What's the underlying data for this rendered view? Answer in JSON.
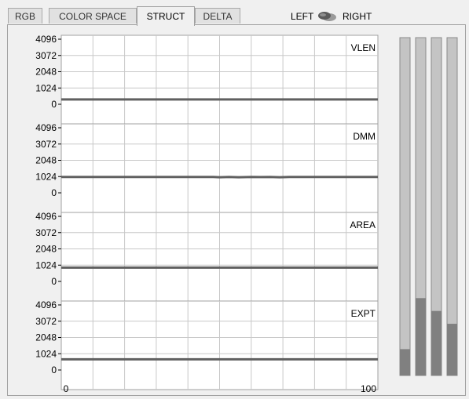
{
  "tabs": [
    {
      "label": "RGB",
      "active": false
    },
    {
      "label": "COLOR SPACE",
      "active": false
    },
    {
      "label": "STRUCT",
      "active": true
    },
    {
      "label": "DELTA",
      "active": false
    }
  ],
  "switch": {
    "left_label": "LEFT",
    "right_label": "RIGHT"
  },
  "charts": [
    {
      "name": "VLEN",
      "yticks": [
        "4096",
        "3072",
        "2048",
        "1024",
        "0"
      ],
      "series": [
        [
          0,
          300
        ],
        [
          100,
          300
        ]
      ]
    },
    {
      "name": "DMM",
      "yticks": [
        "4096",
        "3072",
        "2048",
        "1024",
        "0"
      ],
      "series": [
        [
          0,
          1000
        ],
        [
          48,
          1000
        ],
        [
          50,
          980
        ],
        [
          53,
          1000
        ],
        [
          56,
          980
        ],
        [
          60,
          1000
        ],
        [
          63,
          990
        ],
        [
          66,
          1000
        ],
        [
          69,
          980
        ],
        [
          72,
          1000
        ],
        [
          100,
          1000
        ]
      ]
    },
    {
      "name": "AREA",
      "yticks": [
        "4096",
        "3072",
        "2048",
        "1024",
        "0"
      ],
      "series": [
        [
          0,
          870
        ],
        [
          100,
          870
        ]
      ]
    },
    {
      "name": "EXPT",
      "yticks": [
        "4096",
        "3072",
        "2048",
        "1024",
        "0"
      ],
      "series": [
        [
          0,
          670
        ],
        [
          100,
          670
        ]
      ]
    }
  ],
  "x_axis": {
    "min": "0",
    "max": "100"
  },
  "bars": [
    0.078,
    0.229,
    0.191,
    0.153
  ],
  "colors": {
    "line": "#606060",
    "bar_fill": "#808080",
    "bar_track": "#c4c4c4",
    "grid": "#c8c8c8"
  }
}
